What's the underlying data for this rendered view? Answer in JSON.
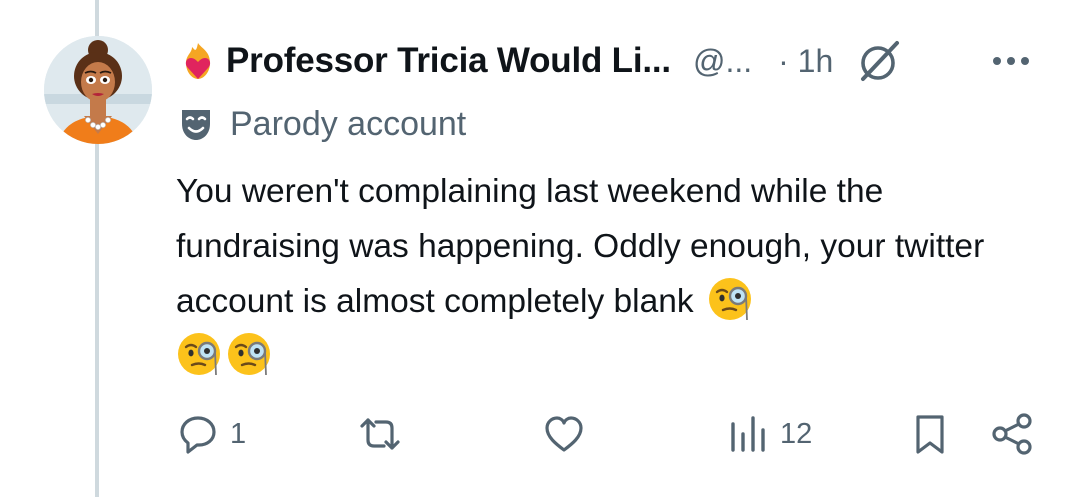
{
  "post": {
    "display_name": "Professor Tricia Would Li...",
    "handle": "@...",
    "time": "· 1h",
    "parody_label": "Parody account",
    "text": "You weren't complaining last weekend while the fundraising was happening. Oddly enough, your twitter account is almost completely blank",
    "emojis": [
      "face-with-monocle-icon",
      "face-with-monocle-icon",
      "face-with-monocle-icon"
    ]
  },
  "actions": {
    "reply_count": "1",
    "repost_count": "",
    "like_count": "",
    "views_count": "12"
  },
  "colors": {
    "text": "#0f1419",
    "muted": "#536471",
    "thread_line": "#cfd9de"
  },
  "icons": {
    "name_prefix": "fire-heart-icon",
    "grok": "grok-icon",
    "more": "more-horizontal-icon",
    "parody": "theater-mask-icon",
    "reply": "reply-icon",
    "repost": "repost-icon",
    "like": "like-icon",
    "views": "views-icon",
    "bookmark": "bookmark-icon",
    "share": "share-icon"
  }
}
